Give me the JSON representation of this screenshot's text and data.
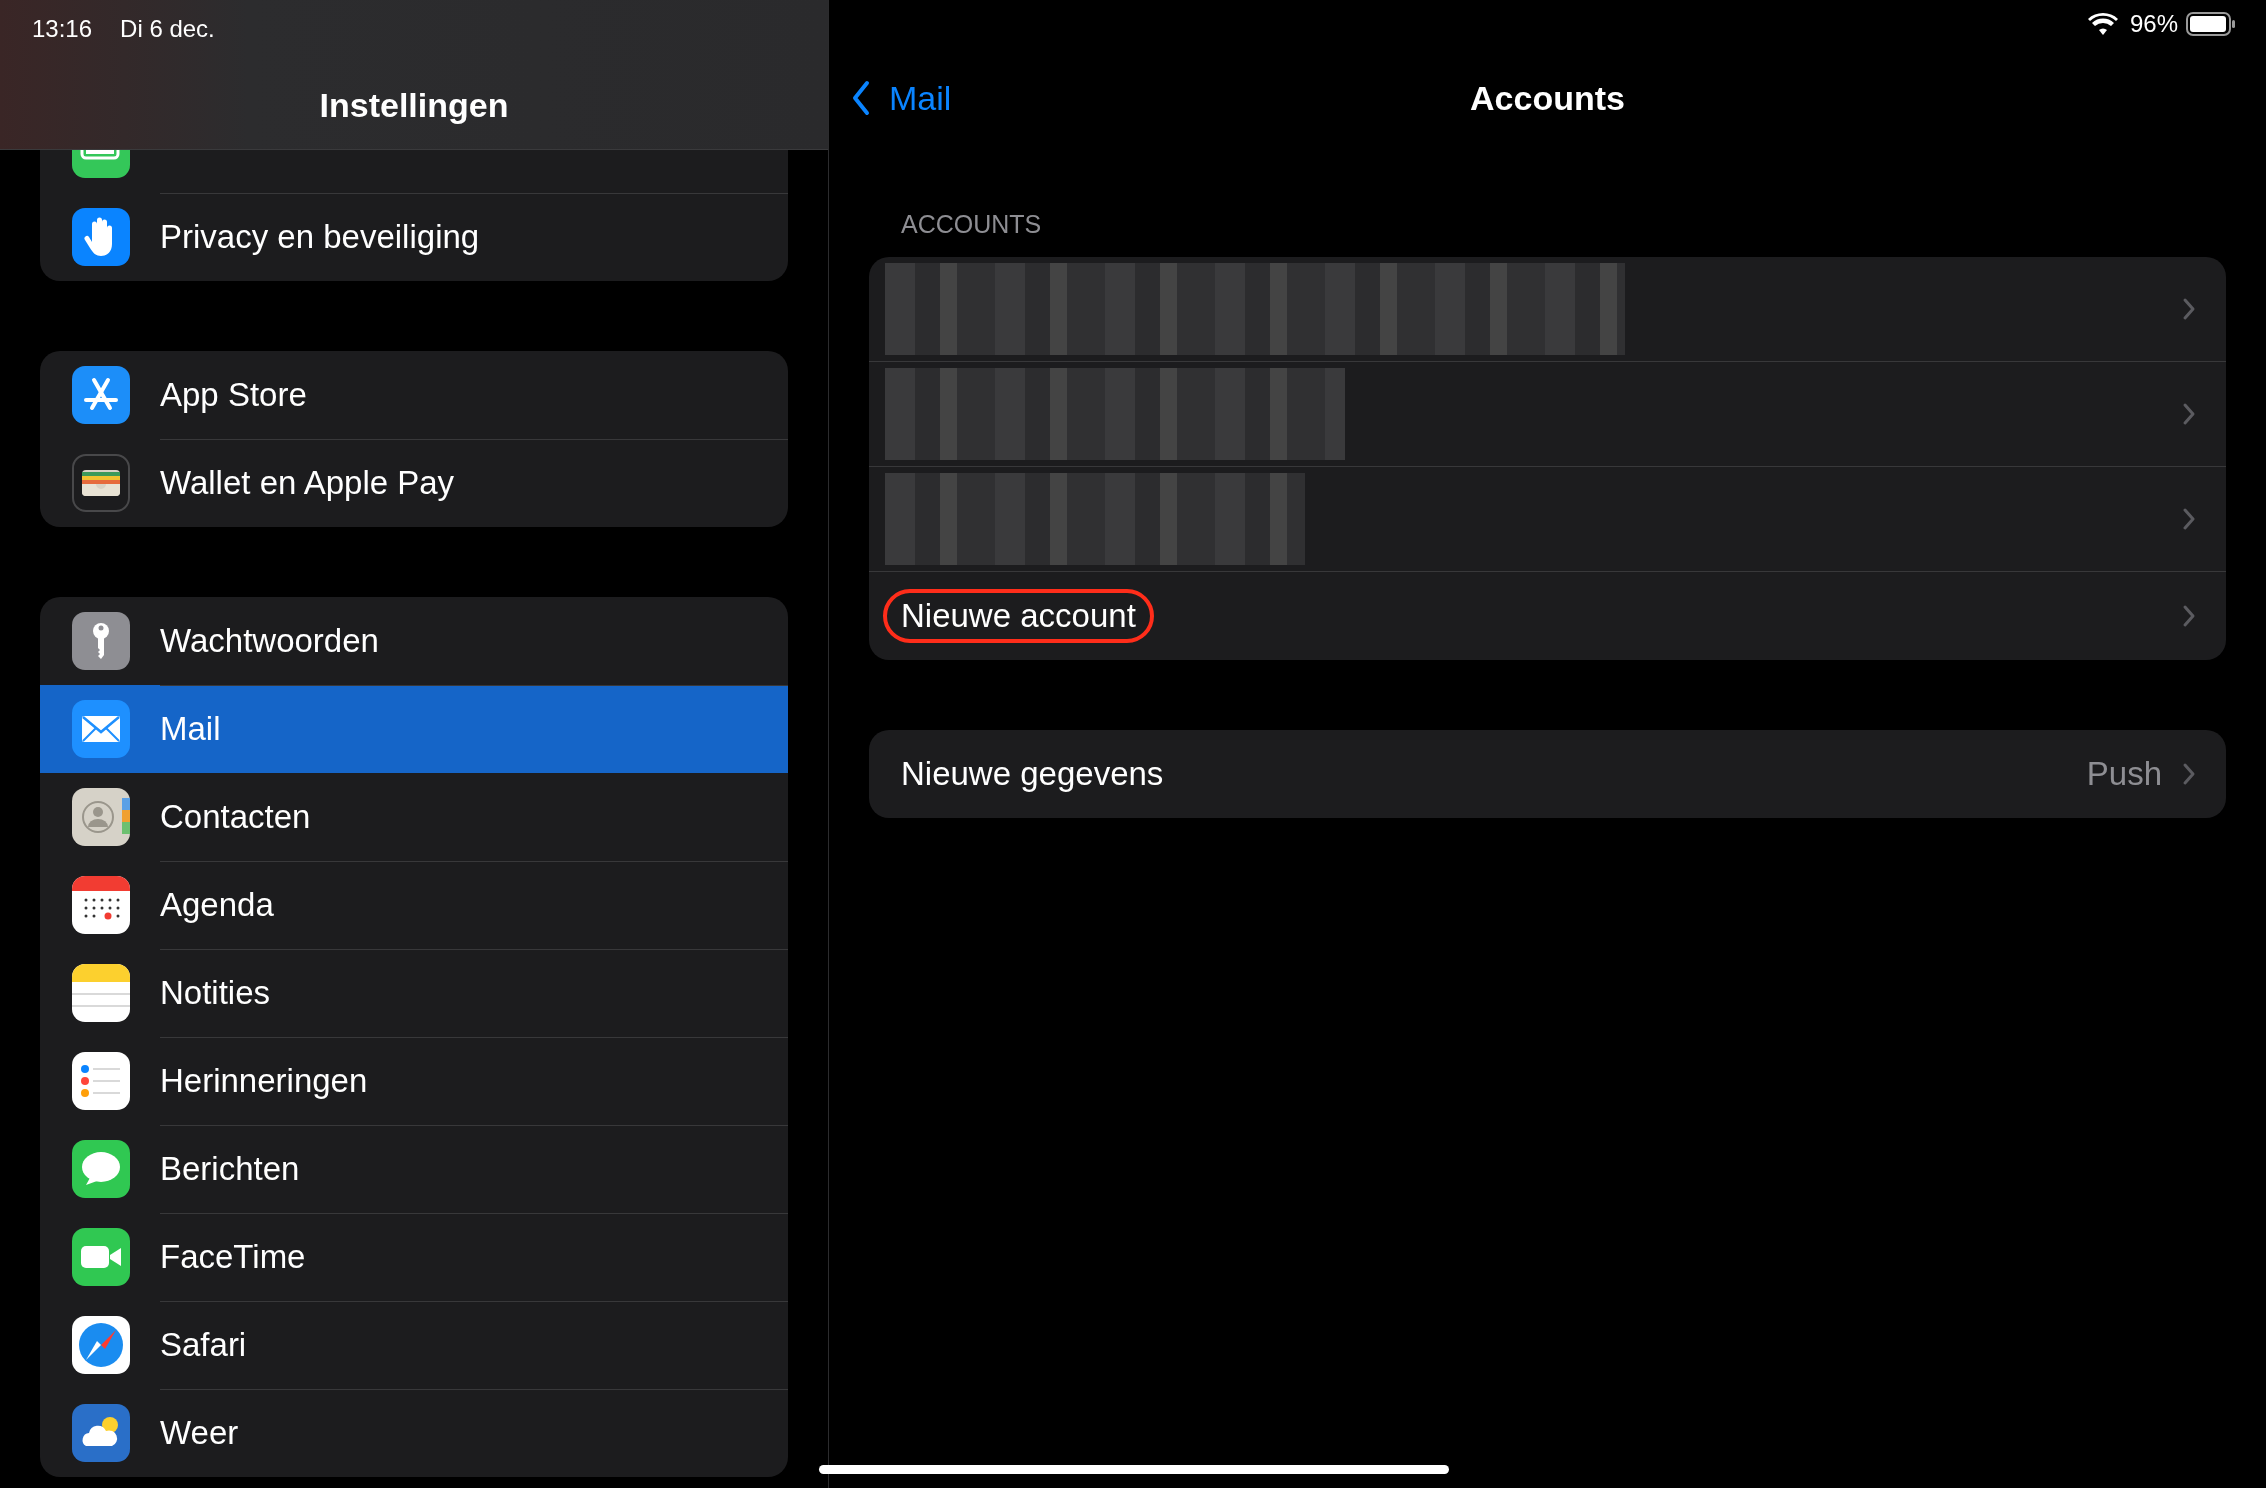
{
  "status_bar": {
    "time": "13:16",
    "date": "Di 6 dec.",
    "battery": "96%"
  },
  "sidebar": {
    "title": "Instellingen",
    "groups": [
      {
        "items": [
          {
            "selected": false
          },
          {
            "label": "Privacy en beveiliging",
            "selected": false
          }
        ]
      },
      {
        "items": [
          {
            "label": "App Store",
            "selected": false
          },
          {
            "label": "Wallet en Apple Pay",
            "selected": false
          }
        ]
      },
      {
        "items": [
          {
            "label": "Wachtwoorden",
            "selected": false
          },
          {
            "label": "Mail",
            "selected": true
          },
          {
            "label": "Contacten",
            "selected": false
          },
          {
            "label": "Agenda",
            "selected": false
          },
          {
            "label": "Notities",
            "selected": false
          },
          {
            "label": "Herinneringen",
            "selected": false
          },
          {
            "label": "Berichten",
            "selected": false
          },
          {
            "label": "FaceTime",
            "selected": false
          },
          {
            "label": "Safari",
            "selected": false
          },
          {
            "label": "Weer",
            "selected": false
          }
        ]
      }
    ]
  },
  "detail": {
    "back": "Mail",
    "title": "Accounts",
    "accounts_header": "ACCOUNTS",
    "accounts": [
      {
        "kind": "redacted"
      },
      {
        "kind": "redacted"
      },
      {
        "kind": "redacted"
      },
      {
        "kind": "link",
        "label": "Nieuwe account",
        "circled": true
      }
    ],
    "fetch": {
      "label": "Nieuwe gegevens",
      "value": "Push"
    }
  }
}
